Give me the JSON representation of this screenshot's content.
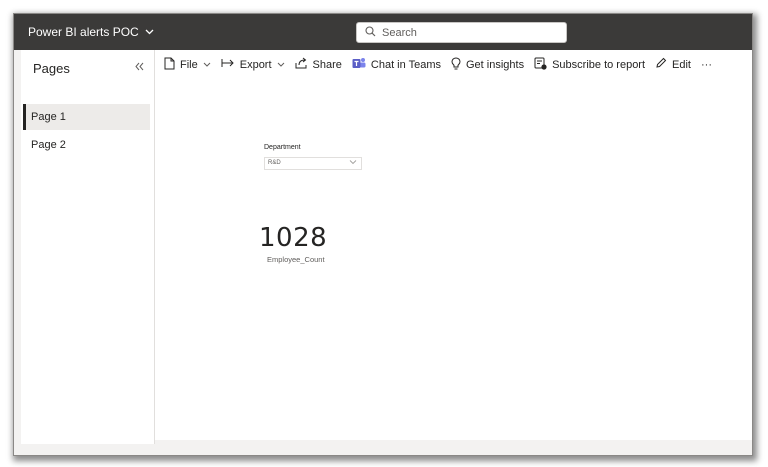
{
  "app": {
    "title": "Power BI alerts POC",
    "title_chevron": "chevron-down-icon"
  },
  "search": {
    "placeholder": "Search",
    "icon": "search-icon"
  },
  "pages_pane": {
    "header": "Pages",
    "collapse_icon": "double-chevron-left-icon",
    "items": [
      {
        "label": "Page 1",
        "active": true
      },
      {
        "label": "Page 2",
        "active": false
      }
    ]
  },
  "toolbar": {
    "file": "File",
    "export": "Export",
    "share": "Share",
    "chat_in_teams": "Chat in Teams",
    "get_insights": "Get insights",
    "subscribe": "Subscribe to report",
    "edit": "Edit",
    "more": "···"
  },
  "report": {
    "slicer": {
      "label": "Department",
      "value": "R&D"
    },
    "card": {
      "value": "1028",
      "label": "Employee_Count"
    }
  },
  "colors": {
    "topbar": "#3b3a39",
    "teams_accent": "#5b5fc7",
    "background": "#f3f2f1"
  }
}
